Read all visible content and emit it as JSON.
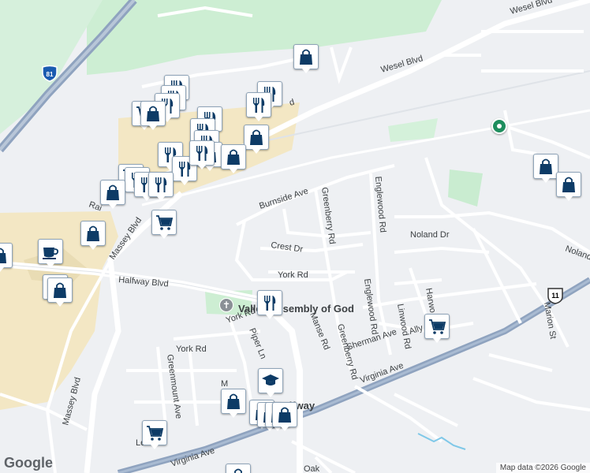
{
  "streets": {
    "wesel_blvd_east": "Wesel Blvd",
    "wesel_blvd_mid": "Wesel Blvd",
    "halfway_blvd": "Halfway Blvd",
    "massey_blvd_north": "Massey Blvd",
    "massey_blvd_south": "Massey Blvd",
    "burnside_ave": "Burnside Ave",
    "greenberry_rd_north": "Greenberry Rd",
    "englewood_rd_north": "Englewood Rd",
    "noland_dr": "Noland Dr",
    "noland_dr_east": "Noland",
    "crest_dr": "Crest Dr",
    "york_rd_east": "York Rd",
    "york_rd_mid": "York Rd",
    "york_rd_west": "York Rd",
    "englewood_rd_south": "Englewood Rd",
    "harwood": "Harwo",
    "linwood_rd": "Linwood Rd",
    "marion_st": "Marion St",
    "sherman_ave": "Sherman Ave",
    "ally": "Ally",
    "manse_rd": "Manse Rd",
    "greenberry_rd_south": "Greenberry Rd",
    "piper_ln": "Piper Ln",
    "greenmount_ave": "Greenmount Ave",
    "virginia_ave_east": "Virginia Ave",
    "virginia_ave_west": "Virginia Ave",
    "oak": "Oak",
    "rail": "Rai",
    "le": "Le",
    "m": "M",
    "d": "d",
    "blvd_fragment": "d"
  },
  "places": {
    "church": "Valley Assembly of God",
    "halfway": "Halfway"
  },
  "shields": {
    "interstate": "81",
    "us_route": "11"
  },
  "markers": [
    {
      "icon": "shopping-bag-icon"
    },
    {
      "icon": "restaurant-icon"
    },
    {
      "icon": "shopping-cart-icon"
    },
    {
      "icon": "coffee-icon"
    },
    {
      "icon": "school-icon"
    }
  ],
  "branding": {
    "logo": "Google",
    "attribution": "Map data ©2026 Google"
  },
  "colors": {
    "marker_icon": "#0d3b66",
    "road": "#ffffff",
    "highway": "#8fa3bf",
    "commercial": "#f3e7c4",
    "park": "#cdeed3",
    "background": "#eef0f3",
    "water": "#7fc8e8"
  }
}
